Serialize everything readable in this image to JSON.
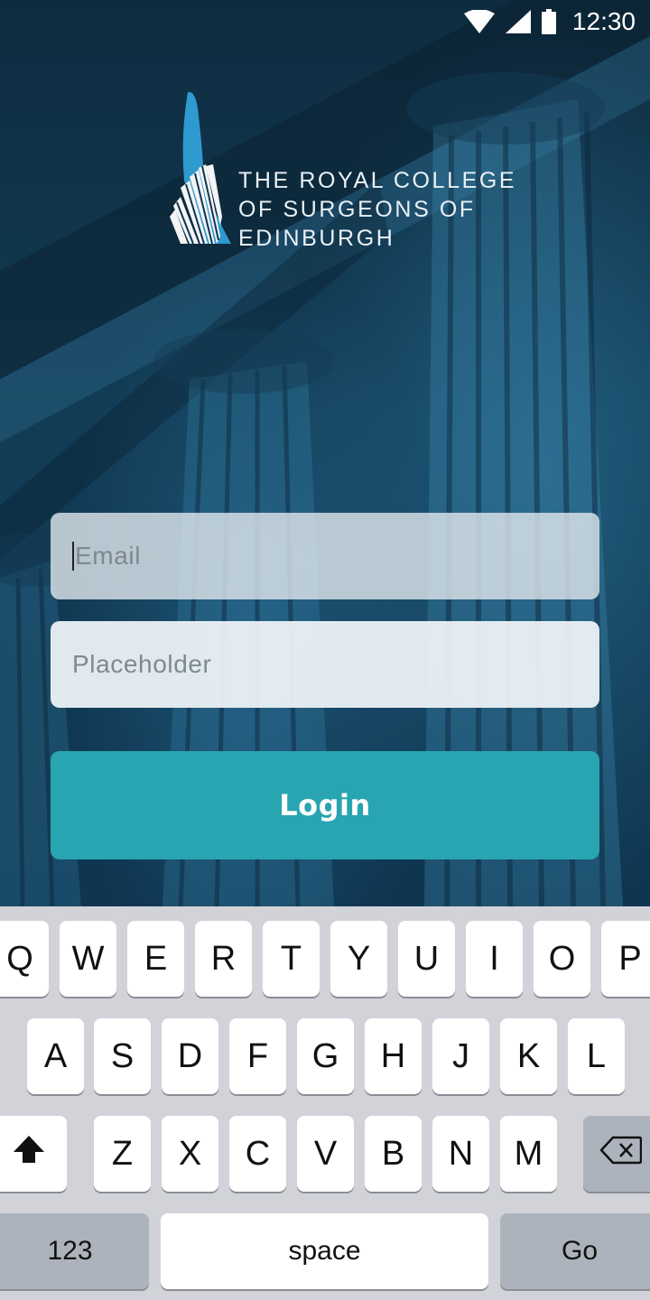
{
  "status_bar": {
    "time": "12:30",
    "icons": [
      "wifi-icon",
      "cellular-signal-icon",
      "battery-icon"
    ]
  },
  "logo": {
    "lines": [
      "THE ROYAL COLLEGE",
      "OF SURGEONS OF",
      "EDINBURGH"
    ]
  },
  "form": {
    "email_placeholder": "Email",
    "password_placeholder": "Placeholder",
    "login_label": "Login"
  },
  "keyboard": {
    "row1": [
      "Q",
      "W",
      "E",
      "R",
      "T",
      "Y",
      "U",
      "I",
      "O",
      "P"
    ],
    "row2": [
      "A",
      "S",
      "D",
      "F",
      "G",
      "H",
      "J",
      "K",
      "L"
    ],
    "row3": [
      "Z",
      "X",
      "C",
      "V",
      "B",
      "N",
      "M"
    ],
    "numbers_label": "123",
    "space_label": "space",
    "go_label": "Go",
    "shift_icon": "shift-icon",
    "backspace_icon": "backspace-icon"
  },
  "colors": {
    "accent": "#28a5b0",
    "background": "#123c56",
    "keyboard": "#d1d3d9"
  }
}
